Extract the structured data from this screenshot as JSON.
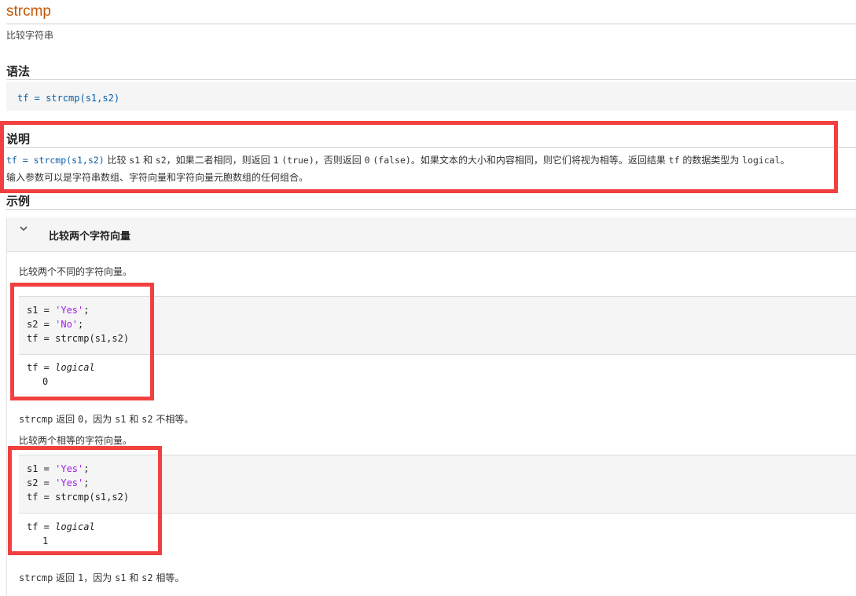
{
  "page": {
    "title": "strcmp",
    "subtitle": "比较字符串"
  },
  "syntax": {
    "heading": "语法",
    "code": "tf = strcmp(s1,s2)"
  },
  "description": {
    "heading": "说明",
    "line1": {
      "code": "tf = strcmp(s1,s2)",
      "t1": " 比较 ",
      "s1": "s1",
      "t2": " 和 ",
      "s2": "s2",
      "t3": "，如果二者相同，则返回 ",
      "one": "1",
      "true_val": "(true)",
      "t4": "，否则返回 ",
      "zero": "0",
      "false_val": "(false)",
      "t5": "。如果文本的大小和内容相同，则它们将视为相等。返回结果 ",
      "tf": "tf",
      "t6": " 的数据类型为 ",
      "logical": "logical",
      "t7": "。"
    },
    "line2": "输入参数可以是字符串数组、字符向量和字符向量元胞数组的任何组合。"
  },
  "examples": {
    "heading": "示例",
    "section_title": "比较两个字符向量",
    "intro1": "比较两个不同的字符向量。",
    "ex1": {
      "l1_pre": "s1 = ",
      "l1_str": "'Yes'",
      "l1_post": ";",
      "l2_pre": "s2 = ",
      "l2_str": "'No'",
      "l2_post": ";",
      "l3": "tf = strcmp(s1,s2)",
      "out_pre": "tf = ",
      "out_type": "logical",
      "out_val": "0"
    },
    "result1": {
      "fn": "strcmp",
      "t1": " 返回 ",
      "val": "0",
      "t2": "，因为 ",
      "s1": "s1",
      "t3": " 和 ",
      "s2": "s2",
      "t4": " 不相等。"
    },
    "intro2": "比较两个相等的字符向量。",
    "ex2": {
      "l1_pre": "s1 = ",
      "l1_str": "'Yes'",
      "l1_post": ";",
      "l2_pre": "s2 = ",
      "l2_str": "'Yes'",
      "l2_post": ";",
      "l3": "tf = strcmp(s1,s2)",
      "out_pre": "tf = ",
      "out_type": "logical",
      "out_val": "1"
    },
    "result2": {
      "fn": "strcmp",
      "t1": " 返回 ",
      "val": "1",
      "t2": "，因为 ",
      "s1": "s1",
      "t3": " 和 ",
      "s2": "s2",
      "t4": " 相等。"
    }
  },
  "colors": {
    "title": "#c45400",
    "code_blue": "#0a5ea8",
    "string_purple": "#a020f0",
    "highlight_red": "#f24040"
  },
  "icons": {
    "collapse": "chevron-down-icon"
  }
}
